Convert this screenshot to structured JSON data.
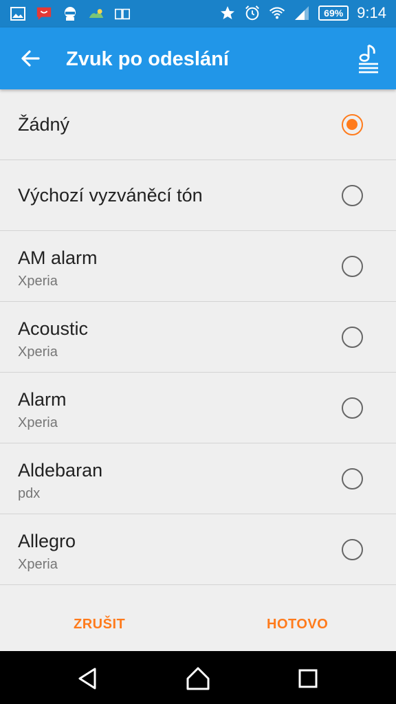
{
  "status_bar": {
    "battery": "69%",
    "time": "9:14",
    "left_icons": [
      "gallery-icon",
      "messaging-icon",
      "android-icon",
      "weather-icon",
      "book-icon"
    ],
    "right_icons": [
      "star-icon",
      "alarm-icon",
      "wifi-icon",
      "signal-icon"
    ]
  },
  "appbar": {
    "title": "Zvuk po odeslání",
    "back_icon": "arrow-back-icon",
    "action_icon": "music-library-icon"
  },
  "options": [
    {
      "title": "Žádný",
      "subtitle": "",
      "selected": true
    },
    {
      "title": "Výchozí vyzváněcí tón",
      "subtitle": "",
      "selected": false
    },
    {
      "title": "AM alarm",
      "subtitle": "Xperia",
      "selected": false
    },
    {
      "title": "Acoustic",
      "subtitle": "Xperia",
      "selected": false
    },
    {
      "title": "Alarm",
      "subtitle": "Xperia",
      "selected": false
    },
    {
      "title": "Aldebaran",
      "subtitle": "pdx",
      "selected": false
    },
    {
      "title": "Allegro",
      "subtitle": "Xperia",
      "selected": false
    }
  ],
  "actions": {
    "cancel": "ZRUŠIT",
    "done": "HOTOVO"
  },
  "nav": [
    "back-icon",
    "home-icon",
    "recents-icon"
  ],
  "colors": {
    "status_bar": "#1a82c9",
    "app_bar": "#2196e8",
    "accent": "#ff7b1c",
    "background": "#efefef"
  }
}
